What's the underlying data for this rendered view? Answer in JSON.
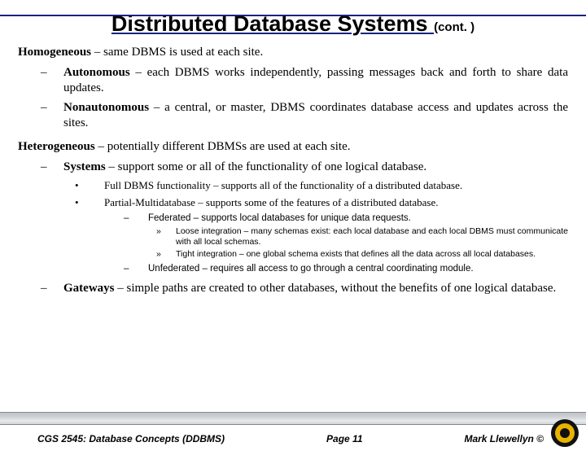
{
  "title": {
    "main": "Distributed Database Systems",
    "cont": "(cont. )"
  },
  "homog": {
    "head_b": "Homogeneous",
    "head_r": " – same DBMS is used at each site.",
    "auto_b": "Autonomous",
    "auto_r": " – each DBMS works independently, passing messages back and forth to share data updates.",
    "non_b": "Nonautonomous",
    "non_r": " – a central, or master, DBMS coordinates database access and updates across the sites."
  },
  "hetero": {
    "head_b": "Heterogeneous",
    "head_r": " – potentially different DBMSs are used at each site.",
    "sys_b": "Systems",
    "sys_r": " – support some or all of the functionality of one logical database.",
    "full_b": "Full DBMS functionality",
    "full_r": " – supports all of the functionality of a distributed database.",
    "part_b": "Partial-Multidatabase",
    "part_r": " – supports some of the features of a distributed database.",
    "fed_b": "Federated",
    "fed_r": " – supports local databases for unique data requests.",
    "loose_b": "Loose integration",
    "loose_r": " – many schemas exist: each local database and each local DBMS must communicate with all local schemas.",
    "tight_b": "Tight integration",
    "tight_r": " – one global schema exists that defines all the data across all local databases.",
    "unfed_b": "Unfederated",
    "unfed_r": " – requires all access to go through a central coordinating module.",
    "gate_b": "Gateways",
    "gate_r": " – simple paths are created to other databases, without the benefits of one logical database."
  },
  "footer": {
    "left": "CGS 2545: Database Concepts (DDBMS)",
    "center": "Page 11",
    "right": "Mark Llewellyn ©"
  }
}
